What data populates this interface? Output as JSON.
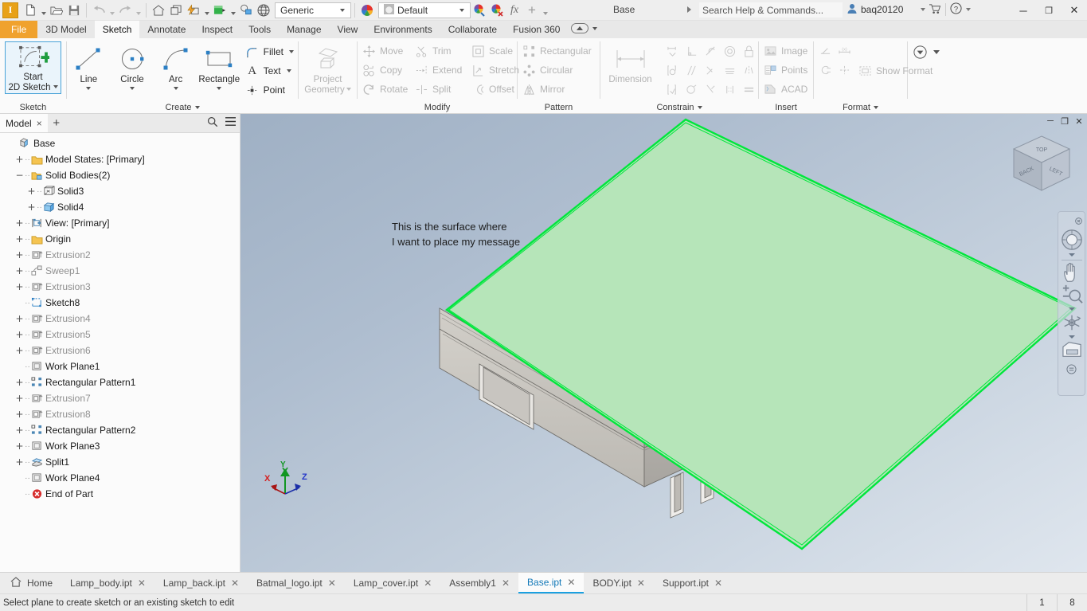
{
  "app": {
    "logo": "I",
    "doc_title": "Base",
    "window_buttons": [
      "minimize",
      "restore",
      "close"
    ]
  },
  "qat": {
    "items": [
      {
        "name": "new-file",
        "icon": "file-icon",
        "caret": true
      },
      {
        "name": "open-file",
        "icon": "folder-open-icon",
        "caret": false
      },
      {
        "name": "save",
        "icon": "save-icon",
        "caret": false
      },
      {
        "name": "undo",
        "icon": "undo-icon",
        "caret": true,
        "disabled": true
      },
      {
        "name": "redo",
        "icon": "redo-icon",
        "caret": true,
        "disabled": true
      },
      {
        "name": "home",
        "icon": "home-icon",
        "caret": false
      },
      {
        "name": "return",
        "icon": "return-icon",
        "caret": false
      },
      {
        "name": "update",
        "icon": "lightning-icon",
        "caret": true
      },
      {
        "name": "material",
        "icon": "material-swatch-icon",
        "caret": true
      },
      {
        "name": "appearance-adjust",
        "icon": "appearance-icon",
        "caret": false
      },
      {
        "name": "clear-appearance",
        "icon": "sphere-grid-icon",
        "caret": false
      }
    ],
    "material_value": "Generic",
    "appearance_value": "Default",
    "appearance_tools": [
      "adjust-icon",
      "clear-icon",
      "fx-icon",
      "plus-icon",
      "dropdown-icon"
    ],
    "search_placeholder": "Search Help & Commands...",
    "user": "baq20120",
    "cart": "cart-icon",
    "help": "help-icon"
  },
  "ribbon_tabs": {
    "items": [
      {
        "label": "File",
        "kind": "file"
      },
      {
        "label": "3D Model",
        "kind": "normal"
      },
      {
        "label": "Sketch",
        "kind": "active"
      },
      {
        "label": "Annotate",
        "kind": "normal"
      },
      {
        "label": "Inspect",
        "kind": "normal"
      },
      {
        "label": "Tools",
        "kind": "normal"
      },
      {
        "label": "Manage",
        "kind": "normal"
      },
      {
        "label": "View",
        "kind": "normal"
      },
      {
        "label": "Environments",
        "kind": "normal"
      },
      {
        "label": "Collaborate",
        "kind": "normal"
      },
      {
        "label": "Fusion 360",
        "kind": "normal"
      }
    ]
  },
  "ribbon": {
    "panels": [
      {
        "title": "Sketch",
        "has_dropdown": false,
        "big_buttons": [
          {
            "label_line1": "Start",
            "label_line2": "2D Sketch",
            "icon": "start-2d-sketch-icon",
            "selected": true,
            "caret": true,
            "disabled": false
          }
        ]
      },
      {
        "title": "Create",
        "has_dropdown": true,
        "big_buttons": [
          {
            "label_line1": "Line",
            "label_line2": "",
            "icon": "line-icon",
            "selected": false,
            "caret": true,
            "disabled": false
          },
          {
            "label_line1": "Circle",
            "label_line2": "",
            "icon": "circle-icon",
            "selected": false,
            "caret": true,
            "disabled": false
          },
          {
            "label_line1": "Arc",
            "label_line2": "",
            "icon": "arc-icon",
            "selected": false,
            "caret": true,
            "disabled": false
          },
          {
            "label_line1": "Rectangle",
            "label_line2": "",
            "icon": "rectangle-icon",
            "selected": false,
            "caret": true,
            "disabled": false
          }
        ],
        "mini_buttons": [
          {
            "label": "Fillet",
            "icon": "fillet-icon",
            "caret": true,
            "disabled": false
          },
          {
            "label": "Text",
            "icon": "text-a-icon",
            "caret": true,
            "disabled": false
          },
          {
            "label": "Point",
            "icon": "point-icon",
            "caret": false,
            "disabled": false
          }
        ]
      },
      {
        "title": "",
        "has_dropdown": false,
        "big_buttons": [
          {
            "label_line1": "Project",
            "label_line2": "Geometry",
            "icon": "project-geometry-icon",
            "selected": false,
            "caret": true,
            "disabled": true
          }
        ]
      },
      {
        "title": "Modify",
        "has_dropdown": false,
        "mini_columns": [
          [
            {
              "label": "Move",
              "icon": "move-icon",
              "disabled": true
            },
            {
              "label": "Copy",
              "icon": "copy-icon",
              "disabled": true
            },
            {
              "label": "Rotate",
              "icon": "rotate-icon",
              "disabled": true
            }
          ],
          [
            {
              "label": "Trim",
              "icon": "trim-icon",
              "disabled": true
            },
            {
              "label": "Extend",
              "icon": "extend-icon",
              "disabled": true
            },
            {
              "label": "Split",
              "icon": "split-icon",
              "disabled": true
            }
          ],
          [
            {
              "label": "Scale",
              "icon": "scale-icon",
              "disabled": true
            },
            {
              "label": "Stretch",
              "icon": "stretch-icon",
              "disabled": true
            },
            {
              "label": "Offset",
              "icon": "offset-icon",
              "disabled": true
            }
          ]
        ]
      },
      {
        "title": "Pattern",
        "has_dropdown": false,
        "mini_columns": [
          [
            {
              "label": "Rectangular",
              "icon": "rectangular-pattern-icon",
              "disabled": true
            },
            {
              "label": "Circular",
              "icon": "circular-pattern-icon",
              "disabled": true
            },
            {
              "label": "Mirror",
              "icon": "mirror-icon",
              "disabled": true
            }
          ]
        ]
      },
      {
        "title": "Constrain",
        "has_dropdown": true,
        "big_buttons": [
          {
            "label_line1": "Dimension",
            "label_line2": "",
            "icon": "dimension-icon",
            "selected": false,
            "caret": false,
            "disabled": true
          }
        ],
        "icon_grid": [
          [
            "auto-dimension-icon",
            "perpendicular-icon",
            "tangent-icon",
            "concentric-icon",
            "fix-icon"
          ],
          [
            "show-constraints-icon",
            "parallel-icon",
            "coincident-icon",
            "collinear-icon",
            "symmetric-icon"
          ],
          [
            "constraint-settings-icon",
            "smooth-icon",
            "horizontal-icon",
            "vertical-icon",
            "equal-icon"
          ]
        ]
      },
      {
        "title": "Insert",
        "has_dropdown": false,
        "mini_columns": [
          [
            {
              "label": "Image",
              "icon": "image-icon",
              "disabled": true
            },
            {
              "label": "Points",
              "icon": "points-icon",
              "disabled": true
            },
            {
              "label": "ACAD",
              "icon": "acad-icon",
              "disabled": true
            }
          ]
        ]
      },
      {
        "title": "Format",
        "has_dropdown": true,
        "mini_columns": [
          [
            {
              "label": "",
              "icon": "construction-line-icon",
              "disabled": true
            },
            {
              "label": "",
              "icon": "driven-dimension-icon",
              "disabled": true
            }
          ],
          [
            {
              "label": "",
              "icon": "centerline-icon",
              "disabled": true
            },
            {
              "label": "",
              "icon": "center-point-icon",
              "disabled": true
            }
          ]
        ],
        "mini_buttons": [
          {
            "label": "Show Format",
            "icon": "show-format-icon",
            "caret": false,
            "disabled": true
          }
        ]
      }
    ],
    "overflow": {
      "icon": "finish-sketch-dropdown-icon",
      "caret": true
    }
  },
  "browser": {
    "tab_label": "Model",
    "tab_close": "×",
    "add_tab": "+",
    "search_icon": "search-icon",
    "menu_icon": "hamburger-menu-icon",
    "tree": [
      {
        "label": "Base",
        "indent": 0,
        "expander": "",
        "icon": "part-icon",
        "gray": false
      },
      {
        "label": "Model States: [Primary]",
        "indent": 1,
        "expander": "+",
        "icon": "folder-icon",
        "gray": false
      },
      {
        "label": "Solid Bodies(2)",
        "indent": 1,
        "expander": "−",
        "icon": "folder-open-bodies-icon",
        "gray": false
      },
      {
        "label": "Solid3",
        "indent": 2,
        "expander": "+",
        "icon": "solid-wire-icon",
        "gray": false
      },
      {
        "label": "Solid4",
        "indent": 2,
        "expander": "+",
        "icon": "solid-blue-icon",
        "gray": false
      },
      {
        "label": "View: [Primary]",
        "indent": 1,
        "expander": "+",
        "icon": "view-icon",
        "gray": false
      },
      {
        "label": "Origin",
        "indent": 1,
        "expander": "+",
        "icon": "folder-icon",
        "gray": false
      },
      {
        "label": "Extrusion2",
        "indent": 1,
        "expander": "+",
        "icon": "extrusion-icon",
        "gray": true
      },
      {
        "label": "Sweep1",
        "indent": 1,
        "expander": "+",
        "icon": "sweep-icon",
        "gray": true
      },
      {
        "label": "Extrusion3",
        "indent": 1,
        "expander": "+",
        "icon": "extrusion-icon",
        "gray": true
      },
      {
        "label": "Sketch8",
        "indent": 1,
        "expander": "",
        "icon": "sketch-icon",
        "gray": false
      },
      {
        "label": "Extrusion4",
        "indent": 1,
        "expander": "+",
        "icon": "extrusion-icon",
        "gray": true
      },
      {
        "label": "Extrusion5",
        "indent": 1,
        "expander": "+",
        "icon": "extrusion-icon",
        "gray": true
      },
      {
        "label": "Extrusion6",
        "indent": 1,
        "expander": "+",
        "icon": "extrusion-icon",
        "gray": true
      },
      {
        "label": "Work Plane1",
        "indent": 1,
        "expander": "",
        "icon": "work-plane-icon",
        "gray": false
      },
      {
        "label": "Rectangular Pattern1",
        "indent": 1,
        "expander": "+",
        "icon": "rect-pattern-icon",
        "gray": false
      },
      {
        "label": "Extrusion7",
        "indent": 1,
        "expander": "+",
        "icon": "extrusion-icon",
        "gray": true
      },
      {
        "label": "Extrusion8",
        "indent": 1,
        "expander": "+",
        "icon": "extrusion-icon",
        "gray": true
      },
      {
        "label": "Rectangular Pattern2",
        "indent": 1,
        "expander": "+",
        "icon": "rect-pattern-icon",
        "gray": false
      },
      {
        "label": "Work Plane3",
        "indent": 1,
        "expander": "+",
        "icon": "work-plane-icon",
        "gray": false
      },
      {
        "label": "Split1",
        "indent": 1,
        "expander": "+",
        "icon": "split-feature-icon",
        "gray": false
      },
      {
        "label": "Work Plane4",
        "indent": 1,
        "expander": "",
        "icon": "work-plane-icon",
        "gray": false
      },
      {
        "label": "End of Part",
        "indent": 1,
        "expander": "",
        "icon": "end-of-part-icon",
        "gray": false
      }
    ]
  },
  "viewport": {
    "annotation_line1": "This is the surface where",
    "annotation_line2": "I want to place my message",
    "window_controls": [
      "–",
      "❐",
      "✕"
    ],
    "axes": {
      "x": "X",
      "y": "Y",
      "z": "Z"
    },
    "viewcube": {
      "top": "TOP",
      "front_left": "BACK",
      "front_right": "LEFT"
    },
    "highlight_color": "#00e63c",
    "highlight_fill": "#b6e5b9",
    "body_color": "#c9c6c1",
    "nav_tools": [
      {
        "name": "full-navigation-wheel-icon"
      },
      {
        "name": "pan-icon"
      },
      {
        "name": "zoom-icon"
      },
      {
        "name": "orbit-icon"
      },
      {
        "name": "look-at-icon"
      }
    ]
  },
  "doc_tabs": {
    "items": [
      {
        "label": "Home",
        "icon": "home-icon",
        "active": false,
        "closable": false
      },
      {
        "label": "Lamp_body.ipt",
        "icon": "",
        "active": false,
        "closable": true
      },
      {
        "label": "Lamp_back.ipt",
        "icon": "",
        "active": false,
        "closable": true
      },
      {
        "label": "Batmal_logo.ipt",
        "icon": "",
        "active": false,
        "closable": true
      },
      {
        "label": "Lamp_cover.ipt",
        "icon": "",
        "active": false,
        "closable": true
      },
      {
        "label": "Assembly1",
        "icon": "",
        "active": false,
        "closable": true
      },
      {
        "label": "Base.ipt",
        "icon": "",
        "active": true,
        "closable": true
      },
      {
        "label": "BODY.ipt",
        "icon": "",
        "active": false,
        "closable": true
      },
      {
        "label": "Support.ipt",
        "icon": "",
        "active": false,
        "closable": true
      }
    ]
  },
  "status": {
    "message": "Select plane to create sketch or an existing sketch to edit",
    "cell1": "1",
    "cell2": "8"
  }
}
